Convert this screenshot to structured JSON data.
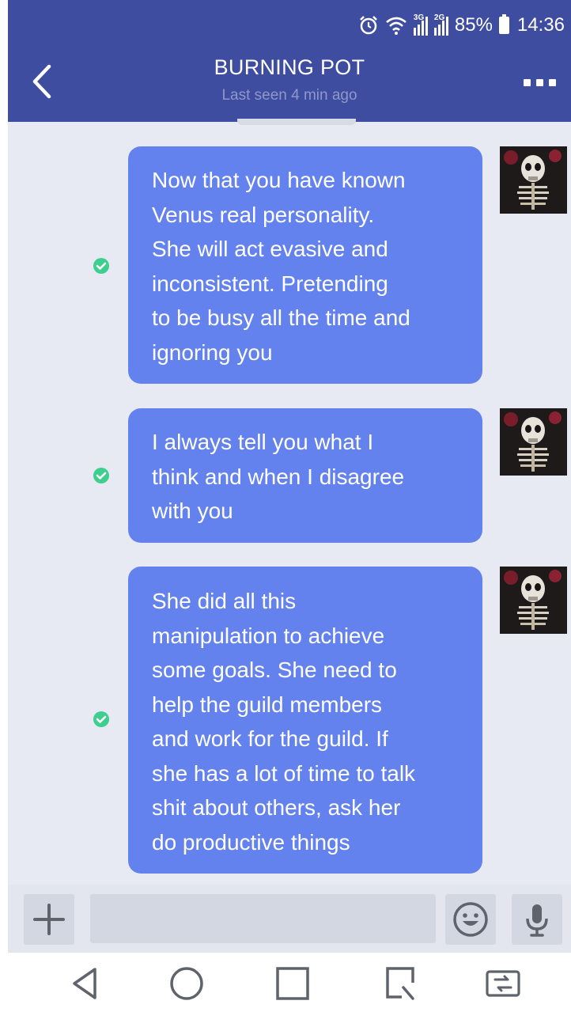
{
  "status_bar": {
    "time": "14:36",
    "battery_percent": "85%",
    "network_labels": [
      "3G",
      "2G"
    ]
  },
  "header": {
    "title": "BURNING POT",
    "subtitle": "Last seen 4 min ago"
  },
  "messages": [
    {
      "lines": [
        "Now that you have known",
        "Venus real personality.",
        "She will act evasive and",
        "inconsistent. Pretending",
        "to be busy all the time and",
        "ignoring you"
      ],
      "status": "read"
    },
    {
      "lines": [
        "I always tell you what I",
        "think and when I disagree",
        "with you"
      ],
      "status": "read"
    },
    {
      "lines": [
        "She did all this",
        "manipulation to achieve",
        "some goals. She need to",
        "help the guild members",
        "and work for the guild. If",
        "she has a lot of time to talk",
        "shit about others, ask her",
        "do productive things"
      ],
      "status": "read"
    }
  ],
  "composer": {
    "input_value": "",
    "buttons": [
      "plus-icon",
      "emoji-icon",
      "microphone-icon"
    ]
  },
  "navigation": {
    "buttons": [
      "back-triangle-icon",
      "home-circle-icon",
      "recents-square-icon",
      "edit-square-icon",
      "switch-screen-icon"
    ]
  },
  "colors": {
    "header_bg": "#3e4d9f",
    "chat_bg": "#e7eaf3",
    "bubble_bg": "#6482ee",
    "read_check": "#3ecf8e",
    "subtitle": "#8e98c9",
    "composer_bg": "#e3e6ee",
    "composer_button_bg": "#d3d7e2",
    "icon_gray": "#5f636b"
  }
}
